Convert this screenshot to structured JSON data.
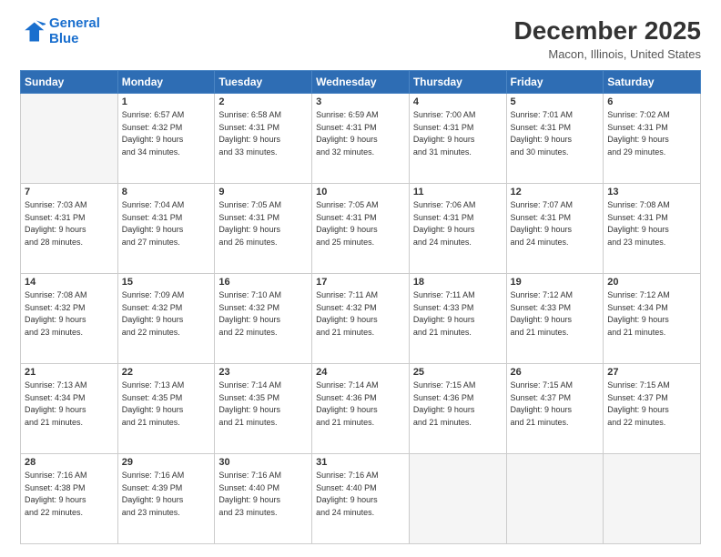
{
  "header": {
    "logo_line1": "General",
    "logo_line2": "Blue",
    "title": "December 2025",
    "subtitle": "Macon, Illinois, United States"
  },
  "days_of_week": [
    "Sunday",
    "Monday",
    "Tuesday",
    "Wednesday",
    "Thursday",
    "Friday",
    "Saturday"
  ],
  "weeks": [
    [
      {
        "day": "",
        "info": ""
      },
      {
        "day": "1",
        "info": "Sunrise: 6:57 AM\nSunset: 4:32 PM\nDaylight: 9 hours\nand 34 minutes."
      },
      {
        "day": "2",
        "info": "Sunrise: 6:58 AM\nSunset: 4:31 PM\nDaylight: 9 hours\nand 33 minutes."
      },
      {
        "day": "3",
        "info": "Sunrise: 6:59 AM\nSunset: 4:31 PM\nDaylight: 9 hours\nand 32 minutes."
      },
      {
        "day": "4",
        "info": "Sunrise: 7:00 AM\nSunset: 4:31 PM\nDaylight: 9 hours\nand 31 minutes."
      },
      {
        "day": "5",
        "info": "Sunrise: 7:01 AM\nSunset: 4:31 PM\nDaylight: 9 hours\nand 30 minutes."
      },
      {
        "day": "6",
        "info": "Sunrise: 7:02 AM\nSunset: 4:31 PM\nDaylight: 9 hours\nand 29 minutes."
      }
    ],
    [
      {
        "day": "7",
        "info": "Sunrise: 7:03 AM\nSunset: 4:31 PM\nDaylight: 9 hours\nand 28 minutes."
      },
      {
        "day": "8",
        "info": "Sunrise: 7:04 AM\nSunset: 4:31 PM\nDaylight: 9 hours\nand 27 minutes."
      },
      {
        "day": "9",
        "info": "Sunrise: 7:05 AM\nSunset: 4:31 PM\nDaylight: 9 hours\nand 26 minutes."
      },
      {
        "day": "10",
        "info": "Sunrise: 7:05 AM\nSunset: 4:31 PM\nDaylight: 9 hours\nand 25 minutes."
      },
      {
        "day": "11",
        "info": "Sunrise: 7:06 AM\nSunset: 4:31 PM\nDaylight: 9 hours\nand 24 minutes."
      },
      {
        "day": "12",
        "info": "Sunrise: 7:07 AM\nSunset: 4:31 PM\nDaylight: 9 hours\nand 24 minutes."
      },
      {
        "day": "13",
        "info": "Sunrise: 7:08 AM\nSunset: 4:31 PM\nDaylight: 9 hours\nand 23 minutes."
      }
    ],
    [
      {
        "day": "14",
        "info": "Sunrise: 7:08 AM\nSunset: 4:32 PM\nDaylight: 9 hours\nand 23 minutes."
      },
      {
        "day": "15",
        "info": "Sunrise: 7:09 AM\nSunset: 4:32 PM\nDaylight: 9 hours\nand 22 minutes."
      },
      {
        "day": "16",
        "info": "Sunrise: 7:10 AM\nSunset: 4:32 PM\nDaylight: 9 hours\nand 22 minutes."
      },
      {
        "day": "17",
        "info": "Sunrise: 7:11 AM\nSunset: 4:32 PM\nDaylight: 9 hours\nand 21 minutes."
      },
      {
        "day": "18",
        "info": "Sunrise: 7:11 AM\nSunset: 4:33 PM\nDaylight: 9 hours\nand 21 minutes."
      },
      {
        "day": "19",
        "info": "Sunrise: 7:12 AM\nSunset: 4:33 PM\nDaylight: 9 hours\nand 21 minutes."
      },
      {
        "day": "20",
        "info": "Sunrise: 7:12 AM\nSunset: 4:34 PM\nDaylight: 9 hours\nand 21 minutes."
      }
    ],
    [
      {
        "day": "21",
        "info": "Sunrise: 7:13 AM\nSunset: 4:34 PM\nDaylight: 9 hours\nand 21 minutes."
      },
      {
        "day": "22",
        "info": "Sunrise: 7:13 AM\nSunset: 4:35 PM\nDaylight: 9 hours\nand 21 minutes."
      },
      {
        "day": "23",
        "info": "Sunrise: 7:14 AM\nSunset: 4:35 PM\nDaylight: 9 hours\nand 21 minutes."
      },
      {
        "day": "24",
        "info": "Sunrise: 7:14 AM\nSunset: 4:36 PM\nDaylight: 9 hours\nand 21 minutes."
      },
      {
        "day": "25",
        "info": "Sunrise: 7:15 AM\nSunset: 4:36 PM\nDaylight: 9 hours\nand 21 minutes."
      },
      {
        "day": "26",
        "info": "Sunrise: 7:15 AM\nSunset: 4:37 PM\nDaylight: 9 hours\nand 21 minutes."
      },
      {
        "day": "27",
        "info": "Sunrise: 7:15 AM\nSunset: 4:37 PM\nDaylight: 9 hours\nand 22 minutes."
      }
    ],
    [
      {
        "day": "28",
        "info": "Sunrise: 7:16 AM\nSunset: 4:38 PM\nDaylight: 9 hours\nand 22 minutes."
      },
      {
        "day": "29",
        "info": "Sunrise: 7:16 AM\nSunset: 4:39 PM\nDaylight: 9 hours\nand 23 minutes."
      },
      {
        "day": "30",
        "info": "Sunrise: 7:16 AM\nSunset: 4:40 PM\nDaylight: 9 hours\nand 23 minutes."
      },
      {
        "day": "31",
        "info": "Sunrise: 7:16 AM\nSunset: 4:40 PM\nDaylight: 9 hours\nand 24 minutes."
      },
      {
        "day": "",
        "info": ""
      },
      {
        "day": "",
        "info": ""
      },
      {
        "day": "",
        "info": ""
      }
    ]
  ]
}
